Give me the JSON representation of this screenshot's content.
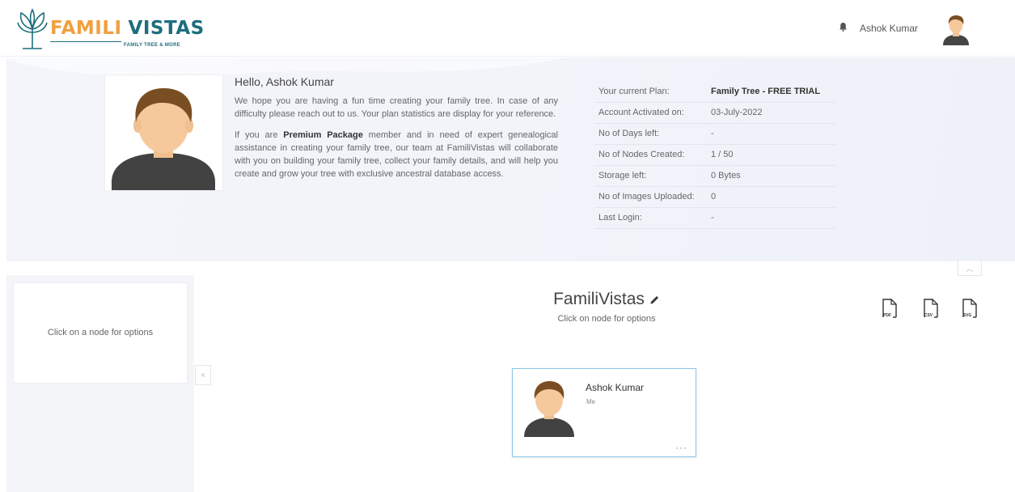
{
  "brand": {
    "word1": "FAMILI",
    "word2": "VISTAS",
    "tagline": "FAMILY TREE & MORE",
    "colors": {
      "orange": "#f0a040",
      "teal": "#1d6e7e"
    }
  },
  "header": {
    "bell_icon": "bell-icon",
    "user_name": "Ashok Kumar"
  },
  "welcome": {
    "greeting": "Hello, Ashok Kumar",
    "para1": "We hope you are having a fun time creating your family tree. In case of any difficulty please reach out to us. Your plan statistics are display for your reference.",
    "para2_prefix": "If you are ",
    "para2_strong": "Premium Package",
    "para2_suffix": " member and in need of expert genealogical assistance in creating your family tree, our team at FamiliVistas will collaborate with you on building your family tree, collect your family details, and will help you create and grow your tree with exclusive ancestral database access."
  },
  "plan": [
    {
      "label": "Your current Plan:",
      "value": "Family Tree - FREE TRIAL"
    },
    {
      "label": "Account Activated on:",
      "value": "03-July-2022"
    },
    {
      "label": "No of Days left:",
      "value": "-"
    },
    {
      "label": "No of Nodes Created:",
      "value": "1 / 50"
    },
    {
      "label": "Storage left:",
      "value": "0 Bytes"
    },
    {
      "label": "No of Images Uploaded:",
      "value": "0"
    },
    {
      "label": "Last Login:",
      "value": "-"
    }
  ],
  "sidebar": {
    "hint": "Click on a node for options",
    "collapse_icon": "chevron-left-icon"
  },
  "tree": {
    "title": "FamiliVistas",
    "subtitle": "Click on node for options",
    "edit_icon": "pencil-icon"
  },
  "exports": [
    {
      "label": "PDF",
      "icon": "pdf-file-icon"
    },
    {
      "label": "CSV",
      "icon": "csv-file-icon"
    },
    {
      "label": "SVG",
      "icon": "svg-file-icon"
    }
  ],
  "node": {
    "name": "Ashok Kumar",
    "relation": "Me",
    "more": "···"
  }
}
